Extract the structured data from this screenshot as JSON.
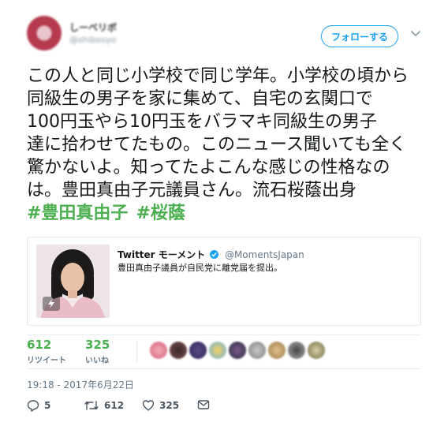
{
  "user": {
    "display_name": "しーベリボ",
    "handle": "@shibesyo",
    "avatar_icon": "profile-avatar-icon"
  },
  "follow_button": {
    "label": "フォローする"
  },
  "tweet": {
    "lines": [
      "この人と同じ小学校で同じ学年。小学校の頃から",
      "同級生の男子を家に集めて、自宅の玄関口で",
      "100円玉やら10円玉をバラマキ同級生の男子",
      "達に拾わせてたもの。このニュース聞いても全く",
      "驚かないよ。知ってたよこんな感じの性格なの",
      "は。豊田真由子元議員さん。流石桜蔭出身"
    ],
    "hashtags": [
      "#豊田真由子",
      "#桜蔭"
    ]
  },
  "moment_card": {
    "source_name": "Twitter モーメント",
    "verified_icon": "verified-badge-icon",
    "handle": "@MomentsJapan",
    "description": "豊田真由子議員が自民党に離党届を提出。"
  },
  "stats": {
    "retweets": "612",
    "retweets_label": "リツイート",
    "likes": "325",
    "likes_label": "いいね"
  },
  "timestamp": "19:18 - 2017年6月22日",
  "actions": {
    "reply_count": "5",
    "retweet_count": "612",
    "like_count": "325"
  },
  "colors": {
    "accent": "#1da1f2",
    "hashtag": "#4caf50",
    "muted": "#657786"
  }
}
